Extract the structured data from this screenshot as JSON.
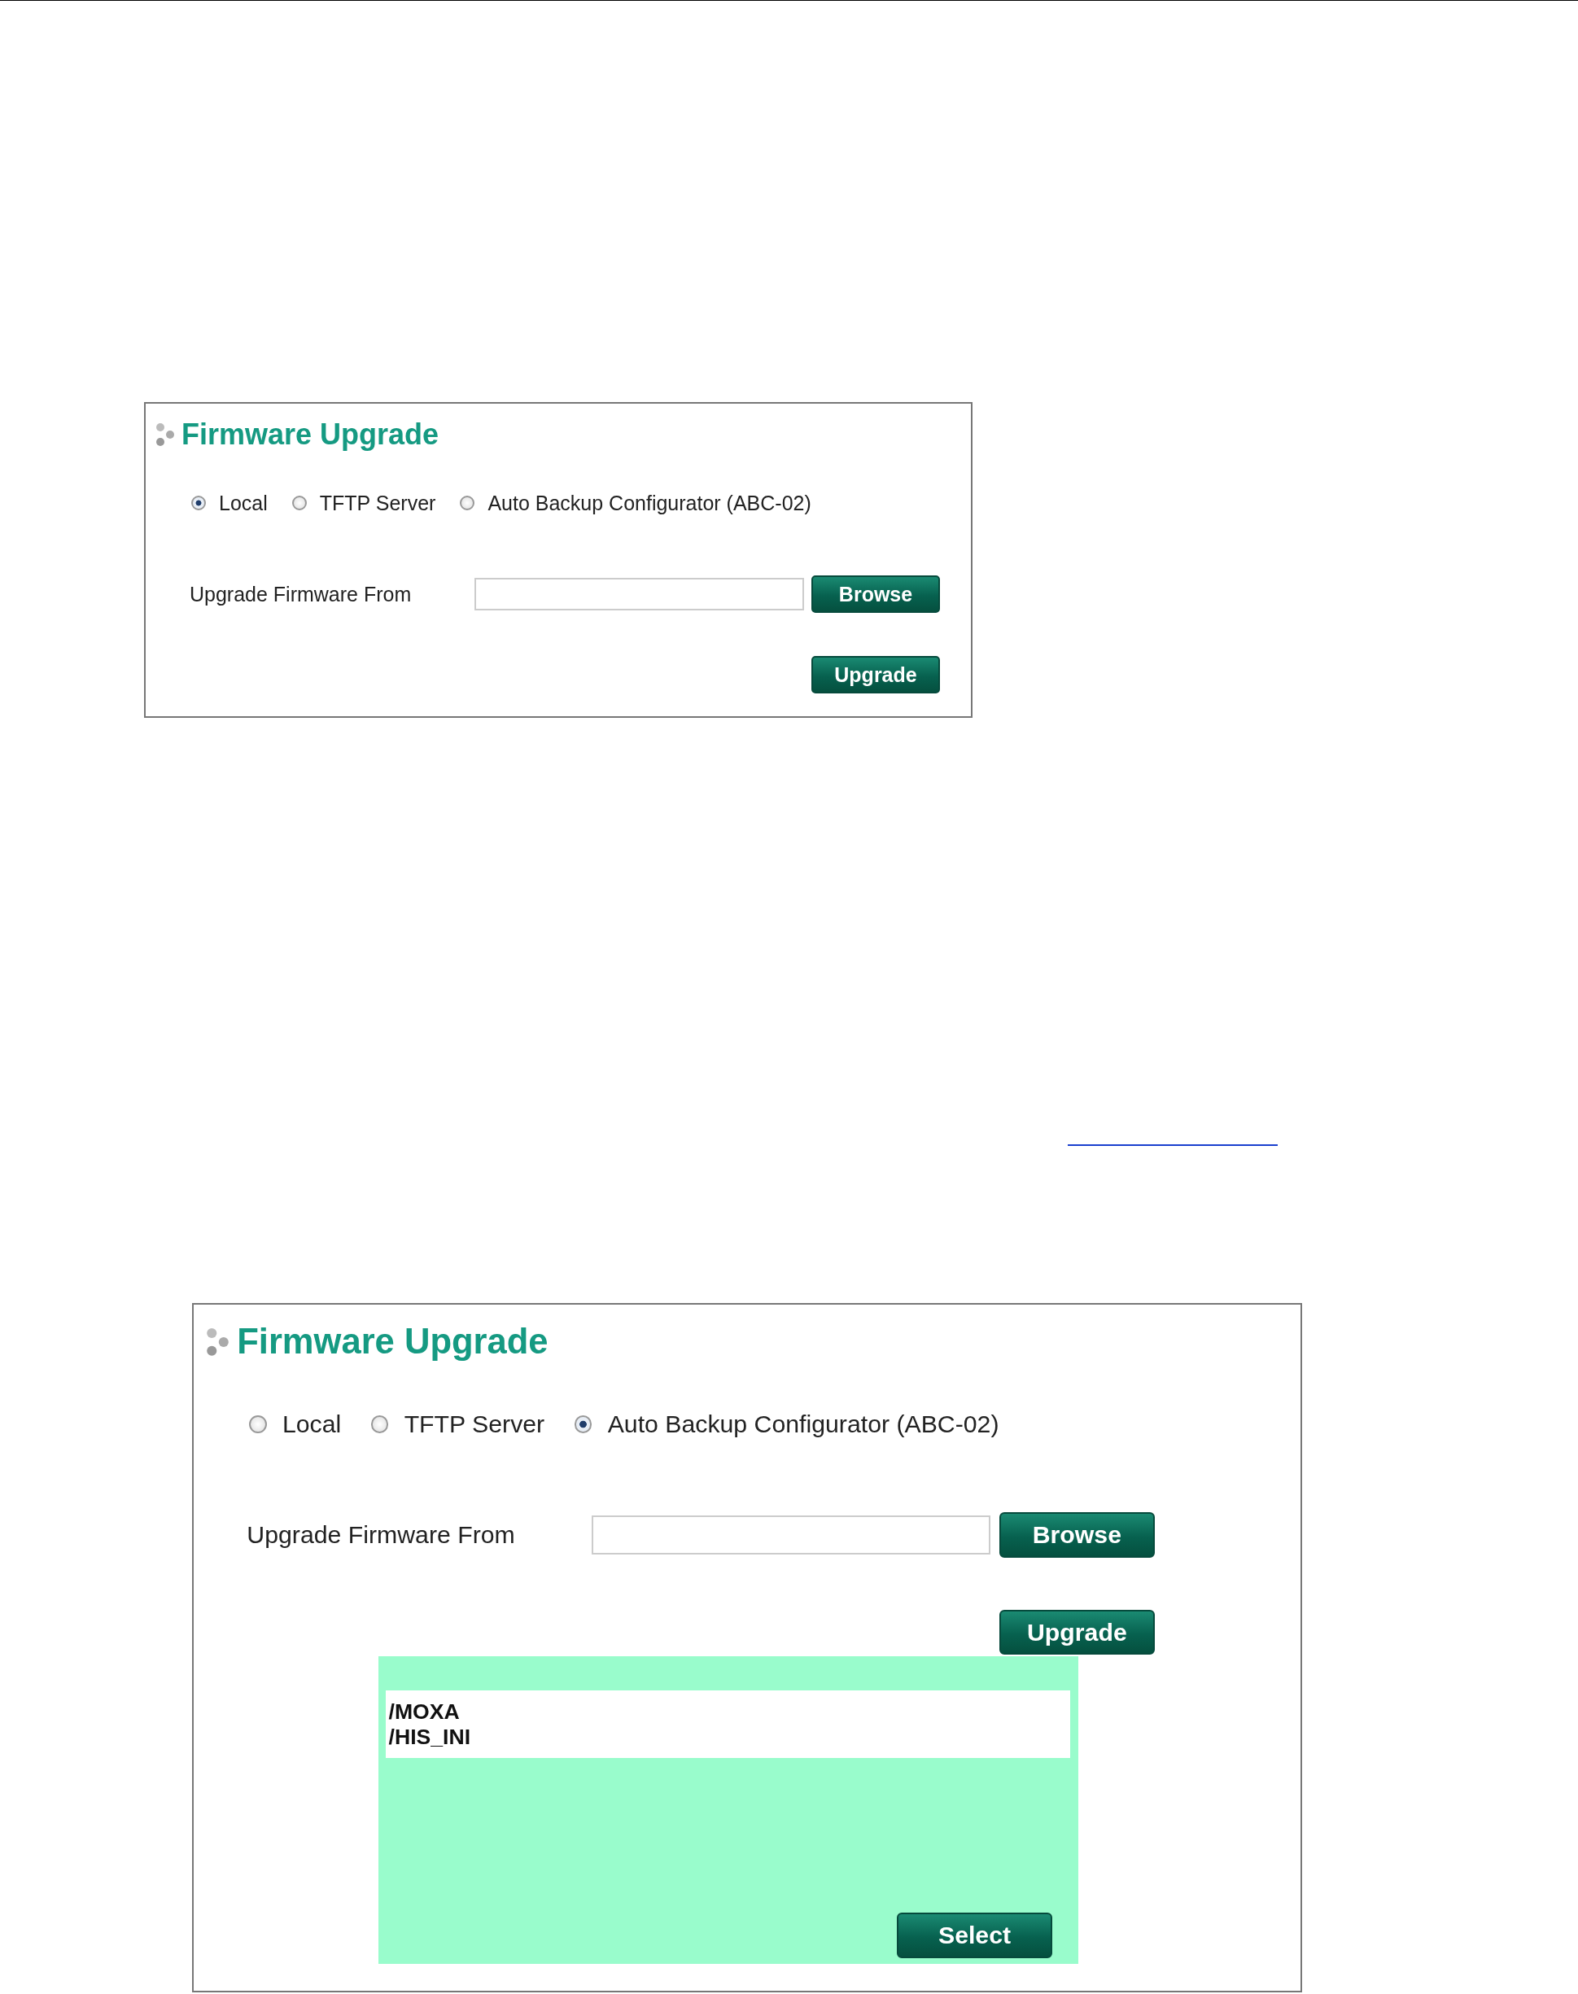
{
  "panels": [
    {
      "title": "Firmware Upgrade",
      "sources": [
        {
          "label": "Local",
          "selected": true
        },
        {
          "label": "TFTP Server",
          "selected": false
        },
        {
          "label": "Auto Backup Configurator (ABC-02)",
          "selected": false
        }
      ],
      "field_label": "Upgrade Firmware From",
      "browse_button": "Browse",
      "upgrade_button": "Upgrade"
    },
    {
      "title": "Firmware Upgrade",
      "sources": [
        {
          "label": "Local",
          "selected": false
        },
        {
          "label": "TFTP Server",
          "selected": false
        },
        {
          "label": "Auto Backup Configurator (ABC-02)",
          "selected": true
        }
      ],
      "field_label": "Upgrade Firmware From",
      "browse_button": "Browse",
      "upgrade_button": "Upgrade",
      "selector": {
        "items": [
          "/MOXA",
          "/HIS_INI"
        ],
        "button": "Select"
      }
    }
  ]
}
